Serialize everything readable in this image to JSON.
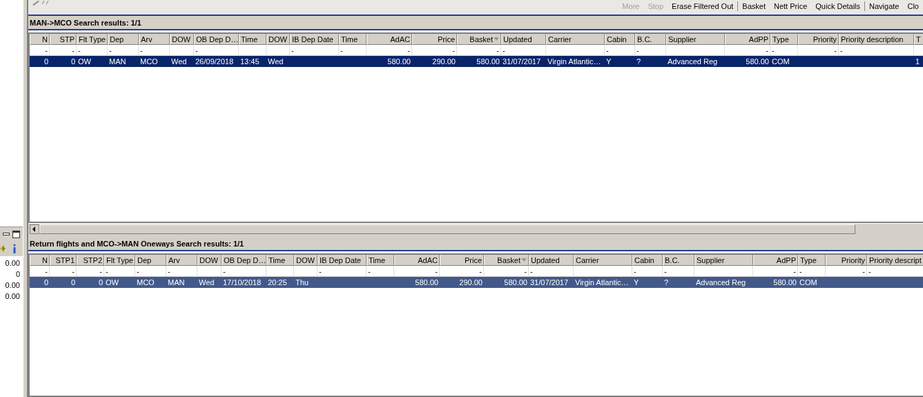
{
  "toolbar": [
    {
      "label": "More",
      "disabled": true
    },
    {
      "label": "Stop",
      "disabled": true
    },
    {
      "label": "Erase Filtered Out",
      "disabled": false,
      "separator_after": true
    },
    {
      "label": "Basket",
      "disabled": false
    },
    {
      "label": "Nett Price",
      "disabled": false
    },
    {
      "label": "Quick Details",
      "disabled": false,
      "separator_after": true
    },
    {
      "label": "Navigate",
      "disabled": false
    },
    {
      "label": "Clo",
      "disabled": false
    }
  ],
  "side_panel": {
    "values": [
      "0.00",
      "0",
      "0.00",
      "0.00"
    ]
  },
  "grids": [
    {
      "title": "MAN->MCO Search results: 1/1",
      "focused": true,
      "scrollbar": true,
      "columns": [
        {
          "label": "N",
          "kind": "number",
          "filter": "-"
        },
        {
          "label": "STP",
          "kind": "number",
          "filter": "-"
        },
        {
          "label": "Flt Type",
          "kind": "text",
          "filter": "-"
        },
        {
          "label": "Dep",
          "kind": "text",
          "filter": "-"
        },
        {
          "label": "Arv",
          "kind": "text",
          "filter": "-"
        },
        {
          "label": "DOW",
          "kind": "text"
        },
        {
          "label": "OB Dep D…",
          "kind": "text",
          "filter": "-"
        },
        {
          "label": "Time",
          "kind": "text"
        },
        {
          "label": "DOW",
          "kind": "text"
        },
        {
          "label": "IB Dep Date",
          "kind": "text",
          "filter": "-"
        },
        {
          "label": "Time",
          "kind": "text",
          "filter": "-"
        },
        {
          "label": "AdAC",
          "kind": "number",
          "filter": "-"
        },
        {
          "label": "Price",
          "kind": "number",
          "filter": "-"
        },
        {
          "label": "Basket",
          "kind": "number",
          "filter": "-",
          "sorted": true
        },
        {
          "label": "Updated",
          "kind": "text",
          "filter": "-"
        },
        {
          "label": "Carrier",
          "kind": "text"
        },
        {
          "label": "Cabin",
          "kind": "text",
          "filter": "-"
        },
        {
          "label": "B.C.",
          "kind": "text",
          "filter": "-"
        },
        {
          "label": "Supplier",
          "kind": "text"
        },
        {
          "label": "AdPP",
          "kind": "number",
          "filter": "-"
        },
        {
          "label": "Type",
          "kind": "text",
          "filter": "-"
        },
        {
          "label": "Priority",
          "kind": "number",
          "filter": "-"
        },
        {
          "label": "Priority description",
          "kind": "text",
          "filter": "-"
        },
        {
          "label": "T",
          "kind": "text"
        }
      ],
      "rows": [
        {
          "selected": true,
          "cells": [
            "0",
            "0",
            "OW",
            "MAN",
            "MCO",
            "Wed",
            "26/09/2018",
            "13:45",
            "Wed",
            null,
            null,
            "580.00",
            "290.00",
            "580.00",
            "31/07/2017",
            "Virgin Atlantic…",
            "Y",
            "?",
            "Advanced Reg",
            "580.00",
            "COM",
            null,
            null,
            "1"
          ]
        }
      ]
    },
    {
      "title": "Return flights and MCO->MAN Oneways Search results: 1/1",
      "focused": false,
      "columns": [
        {
          "label": "N",
          "kind": "number",
          "filter": "-"
        },
        {
          "label": "STP1",
          "kind": "number",
          "filter": "-"
        },
        {
          "label": "STP2",
          "kind": "number",
          "filter": "-"
        },
        {
          "label": "Flt Type",
          "kind": "text",
          "filter": "-"
        },
        {
          "label": "Dep",
          "kind": "text",
          "filter": "-"
        },
        {
          "label": "Arv",
          "kind": "text",
          "filter": "-"
        },
        {
          "label": "DOW",
          "kind": "text"
        },
        {
          "label": "OB Dep D…",
          "kind": "text",
          "filter": "-"
        },
        {
          "label": "Time",
          "kind": "text"
        },
        {
          "label": "DOW",
          "kind": "text"
        },
        {
          "label": "IB Dep Date",
          "kind": "text",
          "filter": "-"
        },
        {
          "label": "Time",
          "kind": "text",
          "filter": "-"
        },
        {
          "label": "AdAC",
          "kind": "number",
          "filter": "-"
        },
        {
          "label": "Price",
          "kind": "number",
          "filter": "-"
        },
        {
          "label": "Basket",
          "kind": "number",
          "filter": "-",
          "sorted": true
        },
        {
          "label": "Updated",
          "kind": "text",
          "filter": "-"
        },
        {
          "label": "Carrier",
          "kind": "text"
        },
        {
          "label": "Cabin",
          "kind": "text",
          "filter": "-"
        },
        {
          "label": "B.C.",
          "kind": "text",
          "filter": "-"
        },
        {
          "label": "Supplier",
          "kind": "text"
        },
        {
          "label": "AdPP",
          "kind": "number",
          "filter": "-"
        },
        {
          "label": "Type",
          "kind": "text",
          "filter": "-"
        },
        {
          "label": "Priority",
          "kind": "number",
          "filter": "-"
        },
        {
          "label": "Priority descript",
          "kind": "text",
          "filter": "-"
        }
      ],
      "rows": [
        {
          "selected": true,
          "cells": [
            "0",
            "0",
            "0",
            "OW",
            "MCO",
            "MAN",
            "Wed",
            "17/10/2018",
            "20:25",
            "Thu",
            null,
            null,
            "580.00",
            "290.00",
            "580.00",
            "31/07/2017",
            "Virgin Atlantic…",
            "Y",
            "?",
            "Advanced Reg",
            "580.00",
            "COM",
            null,
            null
          ]
        }
      ]
    }
  ]
}
